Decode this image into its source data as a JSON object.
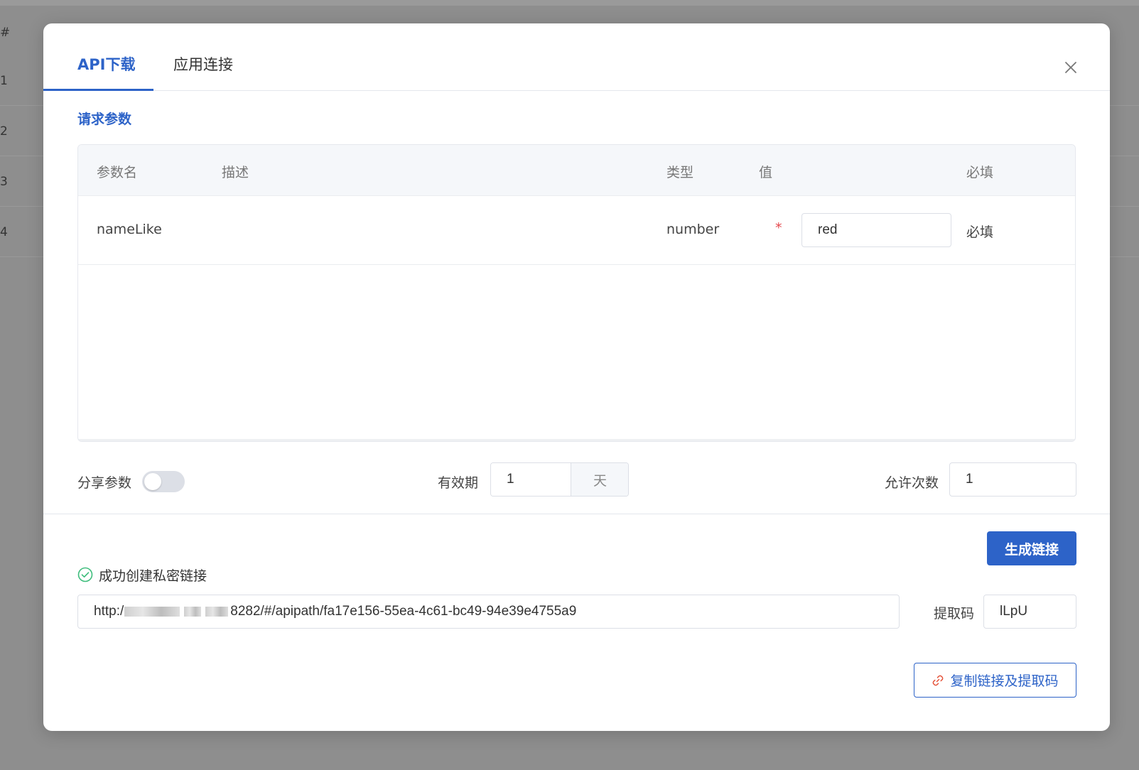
{
  "background": {
    "header_symbol": "#",
    "rows": [
      "1",
      "2",
      "3",
      "4"
    ]
  },
  "tabs": [
    {
      "label": "API下载",
      "active": true
    },
    {
      "label": "应用连接",
      "active": false
    }
  ],
  "icons": {
    "close": "close-icon",
    "success": "check-circle-icon",
    "link": "link-icon"
  },
  "params": {
    "title": "请求参数",
    "columns": [
      "参数名",
      "描述",
      "类型",
      "值",
      "必填"
    ],
    "rows": [
      {
        "name": "nameLike",
        "description": "",
        "type": "number",
        "required_mark": "*",
        "value": "red",
        "required": "必填"
      }
    ]
  },
  "options": {
    "share_label": "分享参数",
    "share_on": false,
    "validity_label": "有效期",
    "validity_value": "1",
    "validity_unit": "天",
    "allowed_label": "允许次数",
    "allowed_value": "1"
  },
  "link": {
    "generate_button": "生成链接",
    "success_text": "成功创建私密链接",
    "url_prefix": "http:/",
    "url_suffix": "8282/#/apipath/fa17e156-55ea-4c61-bc49-94e39e4755a9",
    "code_label": "提取码",
    "code_value": "lLpU",
    "copy_button": "复制链接及提取码"
  },
  "colors": {
    "primary": "#2d63c8",
    "success": "#3ebd7c",
    "danger": "#e5484d"
  }
}
